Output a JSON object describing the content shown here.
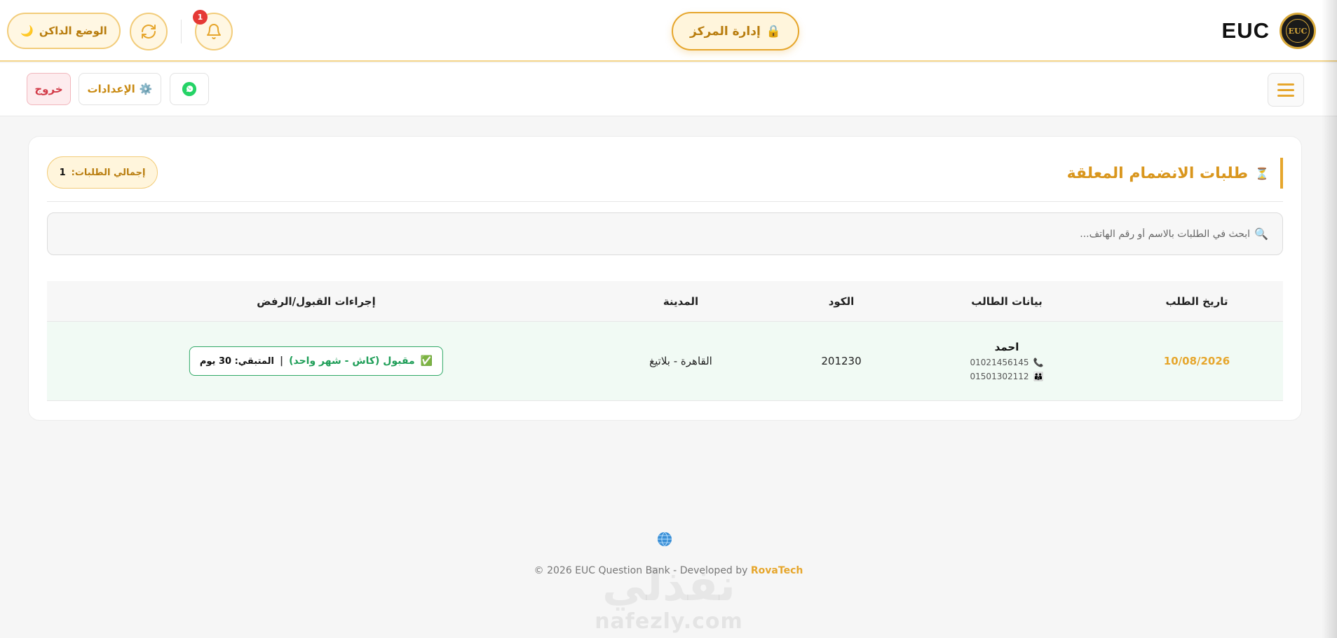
{
  "brand": {
    "name": "EUC",
    "logo_text": "EUC"
  },
  "header": {
    "center_button": "إدارة المركز",
    "notification_count": "1",
    "dark_mode_label": "الوضع الداكن"
  },
  "subbar": {
    "settings_label": "الإعدادات",
    "logout_label": "خروج"
  },
  "card": {
    "title": "طلبات الانضمام المعلقة",
    "total_label": "إجمالي الطلبات:",
    "total_value": "1",
    "search_placeholder": "ابحث في الطلبات بالاسم أو رقم الهاتف..."
  },
  "table": {
    "headers": {
      "date": "تاريخ الطلب",
      "student": "بيانات الطالب",
      "code": "الكود",
      "city": "المدينة",
      "actions": "إجراءات القبول/الرفض"
    },
    "rows": [
      {
        "date": "10/08/2026",
        "name": "احمد",
        "phone": "01021456145",
        "parent_phone": "01501302112",
        "code": "201230",
        "city": "القاهرة - بلاتيغ",
        "status": "مقبول (كاش - شهر واحد)",
        "separator": "|",
        "remaining": "المتبقي: 30 يوم"
      }
    ]
  },
  "footer": {
    "text": "© 2026 EUC Question Bank - Developed by ",
    "developer": "RovaTech"
  },
  "watermark": {
    "line1": "نفذلي",
    "line2": "nafezly.com"
  },
  "colors": {
    "accent": "#e6a62c",
    "success": "#1f9e58",
    "danger": "#d23b48",
    "row_bg": "#f1faf4"
  }
}
